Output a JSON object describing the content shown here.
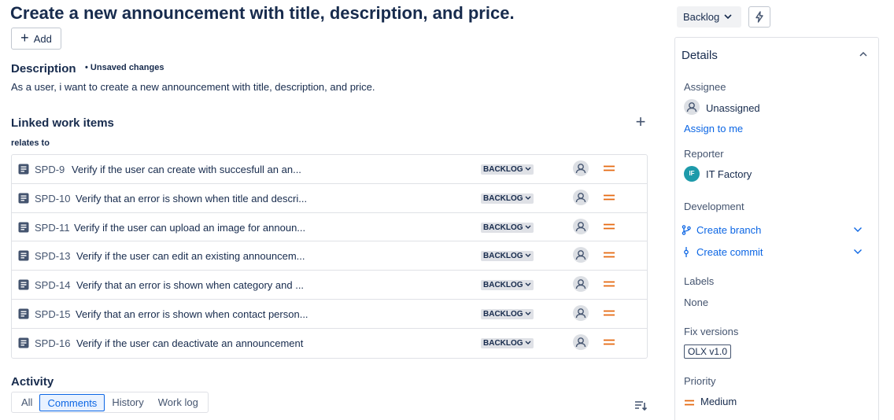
{
  "issue": {
    "title": "Create a new announcement with title, description, and price.",
    "add_label": "Add"
  },
  "description": {
    "heading": "Description",
    "unsaved": "• Unsaved changes",
    "text": "As a user, i want to create a new announcement with title, description, and price."
  },
  "linked": {
    "heading": "Linked work items",
    "relation": "relates to",
    "items": [
      {
        "key": "SPD-9",
        "summary": "Verify if the user can create with succesfull an an...",
        "status": "BACKLOG"
      },
      {
        "key": "SPD-10",
        "summary": "Verify that an error is shown when title and descri...",
        "status": "BACKLOG"
      },
      {
        "key": "SPD-11",
        "summary": "Verify if the user can upload an image for announ...",
        "status": "BACKLOG"
      },
      {
        "key": "SPD-13",
        "summary": "Verify if the user can edit an existing announcem...",
        "status": "BACKLOG"
      },
      {
        "key": "SPD-14",
        "summary": "Verify that an error is shown when category and ...",
        "status": "BACKLOG"
      },
      {
        "key": "SPD-15",
        "summary": "Verify that an error is shown when contact person...",
        "status": "BACKLOG"
      },
      {
        "key": "SPD-16",
        "summary": "Verify if the user can deactivate an announcement",
        "status": "BACKLOG"
      }
    ],
    "story_icon": "story-icon",
    "priority_icon": "priority-medium-icon",
    "priority_color": "#e56910"
  },
  "activity": {
    "heading": "Activity",
    "tabs": [
      "All",
      "Comments",
      "History",
      "Work log"
    ],
    "active_tab": "Comments"
  },
  "header": {
    "status": "Backlog",
    "automation_icon": "lightning-icon"
  },
  "details": {
    "title": "Details",
    "assignee_label": "Assignee",
    "assignee_value": "Unassigned",
    "assign_to_me": "Assign to me",
    "reporter_label": "Reporter",
    "reporter_initials": "IF",
    "reporter_value": "IT Factory",
    "development_label": "Development",
    "create_branch": "Create branch",
    "create_commit": "Create commit",
    "labels_label": "Labels",
    "labels_value": "None",
    "fix_versions_label": "Fix versions",
    "fix_version": "OLX v1.0",
    "priority_label": "Priority",
    "priority_value": "Medium"
  },
  "colors": {
    "link": "#0c66e4",
    "story": "#44546f",
    "reporter_avatar": "#1d9aaa"
  }
}
